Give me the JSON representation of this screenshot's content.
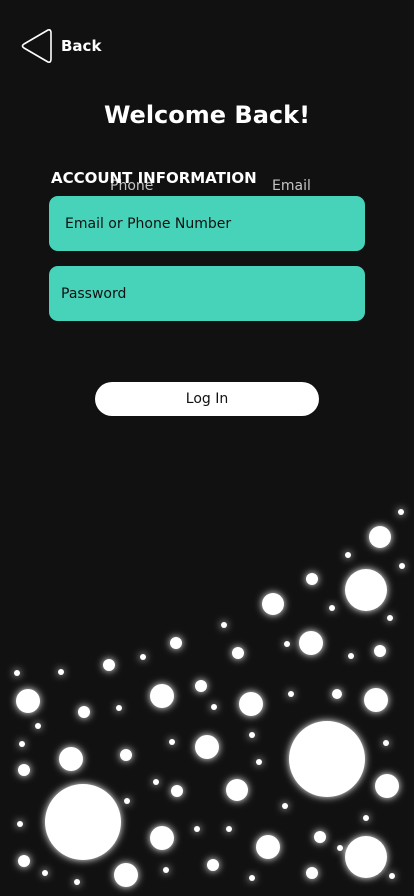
{
  "header": {
    "back_label": "Back"
  },
  "title": "Welcome Back!",
  "account": {
    "section_label": "ACCOUNT INFORMATION",
    "tab_phone": "Phone",
    "tab_email": "Email",
    "email_placeholder": "Email or Phone Number",
    "password_placeholder": "Password"
  },
  "login_label": "Log In",
  "colors": {
    "background": "#111111",
    "field": "#47d3b9",
    "button": "#ffffff",
    "bubble": "#ffffff"
  },
  "icons": {
    "back": "back-arrow-triangle-icon"
  }
}
